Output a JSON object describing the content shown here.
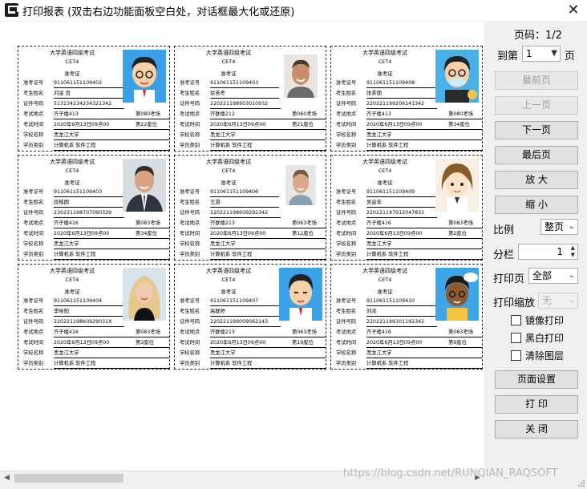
{
  "window": {
    "title": "打印报表 (双击右边功能面板空白处，对话框最大化或还原)",
    "close": "✕"
  },
  "panel": {
    "page_info": "页码：1/2",
    "goto_label": "到第",
    "goto_value": "1",
    "goto_suffix": "页",
    "buttons": {
      "first": "最前页",
      "prev": "上一页",
      "next": "下一页",
      "last": "最后页",
      "zoom_in": "放  大",
      "zoom_out": "缩  小",
      "page_setup": "页面设置",
      "print": "打  印",
      "close": "关  闭"
    },
    "scale_label": "比例",
    "scale_value": "整页",
    "columns_label": "分栏",
    "columns_value": "1",
    "print_pages_label": "打印页",
    "print_pages_value": "全部",
    "print_zoom_label": "打印缩放",
    "print_zoom_value": "无",
    "checkboxes": {
      "mirror": "镜像打印",
      "bw": "黑白打印",
      "clear_layers": "清除图层"
    }
  },
  "ticket_labels": {
    "title": "大学英语四级考试",
    "cet": "CET4",
    "zkz": "准考证",
    "no": "准考证号",
    "name": "考生姓名",
    "id": "证件号码",
    "place": "考试地点",
    "time": "考试时间",
    "school": "学校名称",
    "dept": "学员类别"
  },
  "tickets": [
    {
      "no": "911061151109402",
      "name": "刘凌  良",
      "id": "513134234234321342",
      "place": "齐子楼413",
      "room": "第080考场",
      "time": "2020年6月13日09点00",
      "seat": "第22座位",
      "school": "黑龙江大学",
      "dept": "计算机系  软件工程",
      "photo": "cartoon-glasses"
    },
    {
      "no": "911061151109403",
      "name": "徐苦考",
      "id": "220221198903010932",
      "place": "齐联楼212",
      "room": "第060考场",
      "time": "2020年6月13日09点00",
      "seat": "第21座位",
      "school": "黑龙江大学",
      "dept": "计算机系  软件工程",
      "photo": "man-smile"
    },
    {
      "no": "911061151109408",
      "name": "张茶朋",
      "id": "220221199206141342",
      "place": "齐子楼413",
      "room": "第080考场",
      "time": "2020年6月13日09点00",
      "seat": "第34座位",
      "school": "黑龙江大学",
      "dept": "计算机系  软件工程",
      "photo": "cartoon-mask"
    },
    {
      "no": "911061151109403",
      "name": "段楷朗",
      "id": "230231198707090329",
      "place": "齐子楼416",
      "room": "第083考场",
      "time": "2020年6月13日09点00",
      "seat": "第34座位",
      "school": "黑龙江大学",
      "dept": "计算机系  软件工程",
      "photo": "man-suit"
    },
    {
      "no": "911061151109406",
      "name": "王游",
      "id": "220221198609292342",
      "place": "齐联楼213",
      "room": "第063考场",
      "time": "2020年6月13日09点00",
      "seat": "第12座位",
      "school": "黑龙江大学",
      "dept": "计算机系  软件工程",
      "photo": "man-young"
    },
    {
      "no": "911061151109409",
      "name": "吴益年",
      "id": "220221197912047831",
      "place": "齐子楼416",
      "room": "第083考场",
      "time": "2020年6月13日09点00",
      "seat": "第2座位",
      "school": "黑龙江大学",
      "dept": "计算机系  软件工程",
      "photo": "cartoon-girl"
    },
    {
      "no": "911061151109404",
      "name": "李晰阳",
      "id": "22022119860929031X",
      "place": "齐子楼416",
      "room": "第083考场",
      "time": "2020年6月13日09点00",
      "seat": "第3座位",
      "school": "黑龙江大学",
      "dept": "计算机系  软件工程",
      "photo": "woman-blonde"
    },
    {
      "no": "911061151109407",
      "name": "高联婷",
      "id": "220221199009062143",
      "place": "齐联楼213",
      "room": "第063考场",
      "time": "2020年6月13日09点00",
      "seat": "第19座位",
      "school": "黑龙江大学",
      "dept": "计算机系  软件工程",
      "photo": "cartoon-boy"
    },
    {
      "no": "911061151109410",
      "name": "刘浓",
      "id": "220221199301192342",
      "place": "齐子楼416",
      "room": "第083考场",
      "time": "2020年6月13日09点00",
      "seat": "第9座位",
      "school": "黑龙江大学",
      "dept": "计算机系  软件工程",
      "photo": "cartoon-dark"
    }
  ],
  "watermark": "https://blog.csdn.net/RUNQIAN_RAQSOFT"
}
